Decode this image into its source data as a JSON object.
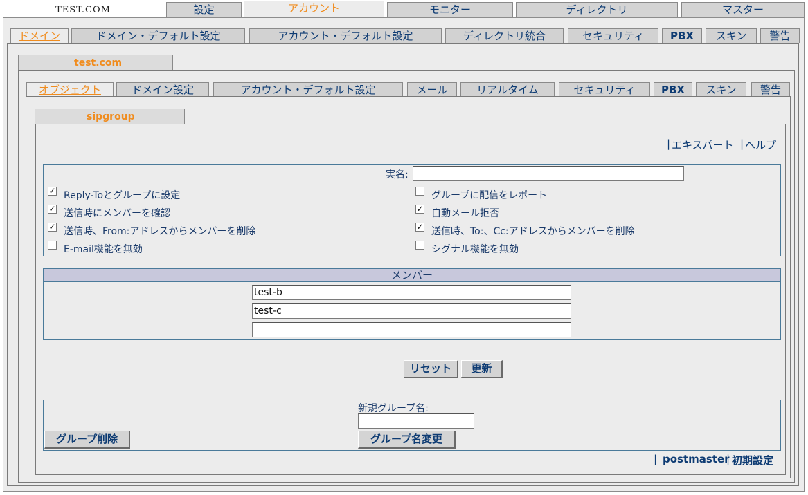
{
  "top_logo": "TEST.COM",
  "top_tabs": [
    "設定",
    "アカウント",
    "モニター",
    "ディレクトリ",
    "マスター"
  ],
  "domain_tabs": [
    "ドメイン",
    "ドメイン・デフォルト設定",
    "アカウント・デフォルト設定",
    "ディレクトリ統合",
    "セキュリティ",
    "PBX",
    "スキン",
    "警告"
  ],
  "domain_name": "test.com",
  "object_tabs": [
    "オブジェクト",
    "ドメイン設定",
    "アカウント・デフォルト設定",
    "メール",
    "リアルタイム",
    "セキュリティ",
    "PBX",
    "スキン",
    "警告"
  ],
  "group_name": "sipgroup",
  "links": {
    "pipe": "|",
    "expert": "エキスパート",
    "help": "ヘルプ"
  },
  "form": {
    "real_name_label": "実名:",
    "real_name_value": "",
    "left_options": [
      {
        "label": "Reply-Toとグループに設定",
        "checked": true,
        "mark": "✓"
      },
      {
        "label": "送信時にメンバーを確認",
        "checked": true,
        "mark": "✓"
      },
      {
        "label": "送信時、From:アドレスからメンバーを削除",
        "checked": true,
        "mark": "✓"
      },
      {
        "label": "E-mail機能を無効",
        "checked": false,
        "mark": ""
      }
    ],
    "right_options": [
      {
        "label": "グループに配信をレポート",
        "checked": false,
        "mark": ""
      },
      {
        "label": "自動メール拒否",
        "checked": true,
        "mark": "✓"
      },
      {
        "label": "送信時、To:、Cc:アドレスからメンバーを削除",
        "checked": true,
        "mark": "✓"
      },
      {
        "label": "シグナル機能を無効",
        "checked": false,
        "mark": ""
      }
    ]
  },
  "members": {
    "header": "メンバー",
    "values": [
      "test-b",
      "test-c",
      ""
    ]
  },
  "buttons": {
    "reset": "リセット",
    "update": "更新",
    "delete_group": "グループ削除",
    "rename_group": "グループ名変更"
  },
  "rename": {
    "label": "新規グループ名:",
    "value": ""
  },
  "footer": {
    "user": "postmaster",
    "settings": "初期設定"
  },
  "colors": {
    "active_tab": "#f08c1e",
    "link": "#0d3b73",
    "member_header_bg": "#c8c8dc"
  }
}
